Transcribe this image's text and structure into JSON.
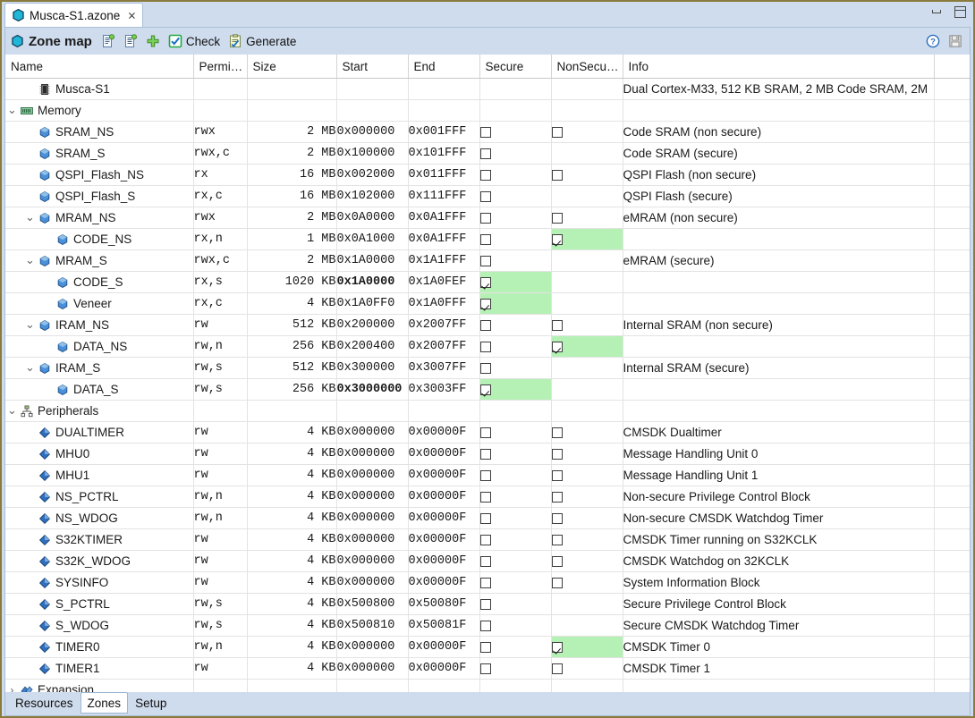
{
  "window": {
    "minimize_label": "Minimize",
    "maximize_label": "Maximize"
  },
  "tab": {
    "title": "Musca-S1.azone",
    "close_glyph": "⨯",
    "icon": "hexagon-icon"
  },
  "toolbar": {
    "form_title": "Zone map",
    "icon": "hexagon-icon",
    "buttons": [
      {
        "name": "add-resource-file",
        "icon": "resource-file-icon",
        "label": ""
      },
      {
        "name": "add-zone-file",
        "icon": "zone-file-icon",
        "label": ""
      },
      {
        "name": "add",
        "icon": "plus-icon",
        "label": ""
      },
      {
        "name": "check",
        "icon": "check-icon",
        "label": "Check"
      },
      {
        "name": "generate",
        "icon": "generate-icon",
        "label": "Generate"
      }
    ],
    "help_label": "?",
    "save_label": "Save"
  },
  "table": {
    "columns": [
      {
        "key": "name",
        "label": "Name"
      },
      {
        "key": "perm",
        "label": "Permi…"
      },
      {
        "key": "size",
        "label": "Size"
      },
      {
        "key": "start",
        "label": "Start"
      },
      {
        "key": "end",
        "label": "End"
      },
      {
        "key": "secure",
        "label": "Secure"
      },
      {
        "key": "nonsecure",
        "label": "NonSecu…"
      },
      {
        "key": "info",
        "label": "Info"
      },
      {
        "key": "extra",
        "label": ""
      }
    ],
    "rows": [
      {
        "indent": 1,
        "twisty": "",
        "icon": "chip-icon",
        "name": "Musca-S1",
        "perm": "",
        "size": "",
        "start": "",
        "end": "",
        "secure": null,
        "nonsecure": null,
        "info": "Dual Cortex-M33, 512 KB SRAM, 2 MB Code SRAM, 2M"
      },
      {
        "indent": 0,
        "twisty": "down",
        "icon": "memory-icon",
        "name": "Memory",
        "perm": "",
        "size": "",
        "start": "",
        "end": "",
        "secure": null,
        "nonsecure": null,
        "info": ""
      },
      {
        "indent": 1,
        "twisty": "",
        "icon": "block-icon",
        "name": "SRAM_NS",
        "perm": "rwx",
        "size": "2 MB",
        "start": "0x000000",
        "end": "0x001FFF",
        "secure": false,
        "nonsecure": false,
        "info": "Code SRAM (non secure)"
      },
      {
        "indent": 1,
        "twisty": "",
        "icon": "block-icon",
        "name": "SRAM_S",
        "perm": "rwx,c",
        "size": "2 MB",
        "start": "0x100000",
        "end": "0x101FFF",
        "secure": false,
        "nonsecure": null,
        "info": "Code SRAM (secure)"
      },
      {
        "indent": 1,
        "twisty": "",
        "icon": "block-icon",
        "name": "QSPI_Flash_NS",
        "perm": "rx",
        "size": "16 MB",
        "start": "0x002000",
        "end": "0x011FFF",
        "secure": false,
        "nonsecure": false,
        "info": "QSPI Flash (non secure)"
      },
      {
        "indent": 1,
        "twisty": "",
        "icon": "block-icon",
        "name": "QSPI_Flash_S",
        "perm": "rx,c",
        "size": "16 MB",
        "start": "0x102000",
        "end": "0x111FFF",
        "secure": false,
        "nonsecure": null,
        "info": "QSPI Flash (secure)"
      },
      {
        "indent": 1,
        "twisty": "down",
        "icon": "block-icon",
        "name": "MRAM_NS",
        "perm": "rwx",
        "size": "2 MB",
        "start": "0x0A0000",
        "end": "0x0A1FFF",
        "secure": false,
        "nonsecure": false,
        "info": "eMRAM (non secure)"
      },
      {
        "indent": 2,
        "twisty": "",
        "icon": "block-icon",
        "name": "CODE_NS",
        "perm": "rx,n",
        "size": "1 MB",
        "start": "0x0A1000",
        "end": "0x0A1FFF",
        "secure": false,
        "nonsecure": true,
        "nonsecure_hl": true,
        "info": ""
      },
      {
        "indent": 1,
        "twisty": "down",
        "icon": "block-icon",
        "name": "MRAM_S",
        "perm": "rwx,c",
        "size": "2 MB",
        "start": "0x1A0000",
        "end": "0x1A1FFF",
        "secure": false,
        "nonsecure": null,
        "info": "eMRAM (secure)"
      },
      {
        "indent": 2,
        "twisty": "",
        "icon": "block-icon",
        "name": "CODE_S",
        "perm": "rx,s",
        "size": "1020 KB",
        "start": "0x1A0000",
        "start_bold": true,
        "end": "0x1A0FEF",
        "secure": true,
        "secure_hl": true,
        "nonsecure": null,
        "info": ""
      },
      {
        "indent": 2,
        "twisty": "",
        "icon": "block-icon",
        "name": "Veneer",
        "perm": "rx,c",
        "size": "4 KB",
        "start": "0x1A0FF0",
        "end": "0x1A0FFF",
        "secure": true,
        "secure_hl": true,
        "nonsecure": null,
        "info": ""
      },
      {
        "indent": 1,
        "twisty": "down",
        "icon": "block-icon",
        "name": "IRAM_NS",
        "perm": "rw",
        "size": "512 KB",
        "start": "0x200000",
        "end": "0x2007FF",
        "secure": false,
        "nonsecure": false,
        "info": "Internal SRAM (non secure)"
      },
      {
        "indent": 2,
        "twisty": "",
        "icon": "block-icon",
        "name": "DATA_NS",
        "perm": "rw,n",
        "size": "256 KB",
        "start": "0x200400",
        "end": "0x2007FF",
        "secure": false,
        "nonsecure": true,
        "nonsecure_hl": true,
        "info": ""
      },
      {
        "indent": 1,
        "twisty": "down",
        "icon": "block-icon",
        "name": "IRAM_S",
        "perm": "rw,s",
        "size": "512 KB",
        "start": "0x300000",
        "end": "0x3007FF",
        "secure": false,
        "nonsecure": null,
        "info": "Internal SRAM (secure)"
      },
      {
        "indent": 2,
        "twisty": "",
        "icon": "block-icon",
        "name": "DATA_S",
        "perm": "rw,s",
        "size": "256 KB",
        "start": "0x3000000",
        "start_bold": true,
        "end": "0x3003FF",
        "secure": true,
        "secure_hl": true,
        "nonsecure": null,
        "info": ""
      },
      {
        "indent": 0,
        "twisty": "down",
        "icon": "peripherals-icon",
        "name": "Peripherals",
        "perm": "",
        "size": "",
        "start": "",
        "end": "",
        "secure": null,
        "nonsecure": null,
        "info": ""
      },
      {
        "indent": 1,
        "twisty": "",
        "icon": "diamond-icon",
        "name": "DUALTIMER",
        "perm": "rw",
        "size": "4 KB",
        "start": "0x000000",
        "end": "0x00000F",
        "secure": false,
        "nonsecure": false,
        "info": "CMSDK Dualtimer"
      },
      {
        "indent": 1,
        "twisty": "",
        "icon": "diamond-icon",
        "name": "MHU0",
        "perm": "rw",
        "size": "4 KB",
        "start": "0x000000",
        "end": "0x00000F",
        "secure": false,
        "nonsecure": false,
        "info": "Message Handling Unit 0"
      },
      {
        "indent": 1,
        "twisty": "",
        "icon": "diamond-icon",
        "name": "MHU1",
        "perm": "rw",
        "size": "4 KB",
        "start": "0x000000",
        "end": "0x00000F",
        "secure": false,
        "nonsecure": false,
        "info": "Message Handling Unit 1"
      },
      {
        "indent": 1,
        "twisty": "",
        "icon": "diamond-icon",
        "name": "NS_PCTRL",
        "perm": "rw,n",
        "size": "4 KB",
        "start": "0x000000",
        "end": "0x00000F",
        "secure": false,
        "nonsecure": false,
        "info": "Non-secure Privilege Control Block"
      },
      {
        "indent": 1,
        "twisty": "",
        "icon": "diamond-icon",
        "name": "NS_WDOG",
        "perm": "rw,n",
        "size": "4 KB",
        "start": "0x000000",
        "end": "0x00000F",
        "secure": false,
        "nonsecure": false,
        "info": "Non-secure CMSDK Watchdog Timer"
      },
      {
        "indent": 1,
        "twisty": "",
        "icon": "diamond-icon",
        "name": "S32KTIMER",
        "perm": "rw",
        "size": "4 KB",
        "start": "0x000000",
        "end": "0x00000F",
        "secure": false,
        "nonsecure": false,
        "info": "CMSDK Timer running on S32KCLK"
      },
      {
        "indent": 1,
        "twisty": "",
        "icon": "diamond-icon",
        "name": "S32K_WDOG",
        "perm": "rw",
        "size": "4 KB",
        "start": "0x000000",
        "end": "0x00000F",
        "secure": false,
        "nonsecure": false,
        "info": "CMSDK Watchdog on 32KCLK"
      },
      {
        "indent": 1,
        "twisty": "",
        "icon": "diamond-icon",
        "name": "SYSINFO",
        "perm": "rw",
        "size": "4 KB",
        "start": "0x000000",
        "end": "0x00000F",
        "secure": false,
        "nonsecure": false,
        "info": "System Information Block"
      },
      {
        "indent": 1,
        "twisty": "",
        "icon": "diamond-icon",
        "name": "S_PCTRL",
        "perm": "rw,s",
        "size": "4 KB",
        "start": "0x500800",
        "end": "0x50080F",
        "secure": false,
        "nonsecure": null,
        "info": "Secure Privilege Control Block"
      },
      {
        "indent": 1,
        "twisty": "",
        "icon": "diamond-icon",
        "name": "S_WDOG",
        "perm": "rw,s",
        "size": "4 KB",
        "start": "0x500810",
        "end": "0x50081F",
        "secure": false,
        "nonsecure": null,
        "info": "Secure CMSDK Watchdog Timer"
      },
      {
        "indent": 1,
        "twisty": "",
        "icon": "diamond-icon",
        "name": "TIMER0",
        "perm": "rw,n",
        "size": "4 KB",
        "start": "0x000000",
        "end": "0x00000F",
        "secure": false,
        "nonsecure": true,
        "nonsecure_hl": true,
        "info": "CMSDK Timer 0"
      },
      {
        "indent": 1,
        "twisty": "",
        "icon": "diamond-icon",
        "name": "TIMER1",
        "perm": "rw",
        "size": "4 KB",
        "start": "0x000000",
        "end": "0x00000F",
        "secure": false,
        "nonsecure": false,
        "info": "CMSDK Timer 1"
      },
      {
        "indent": 0,
        "twisty": "right",
        "icon": "expansion-icon",
        "name": "Expansion",
        "perm": "",
        "size": "",
        "start": "",
        "end": "",
        "secure": null,
        "nonsecure": null,
        "info": ""
      }
    ]
  },
  "bottom_tabs": [
    {
      "label": "Resources",
      "active": false
    },
    {
      "label": "Zones",
      "active": true
    },
    {
      "label": "Setup",
      "active": false
    }
  ],
  "colors": {
    "chrome": "#cfdced",
    "highlight_green": "#b5f0b5",
    "border": "#8a7a3c",
    "accent_blue": "#2a6ebb"
  }
}
